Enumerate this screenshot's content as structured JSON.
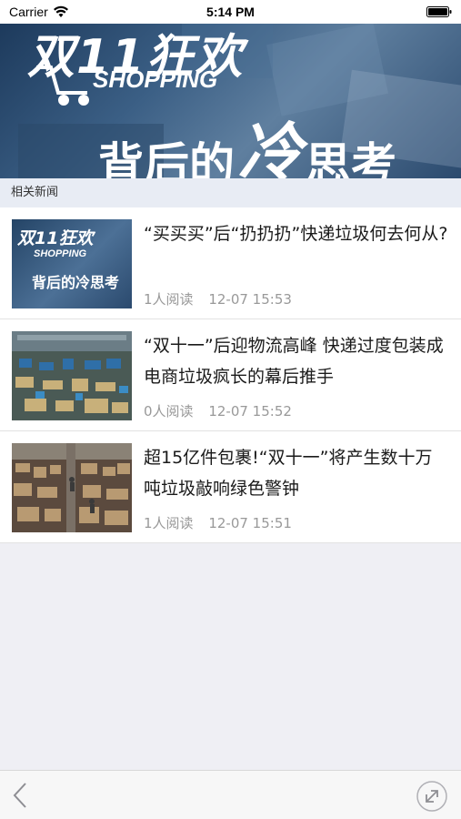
{
  "status_bar": {
    "carrier": "Carrier",
    "time": "5:14 PM"
  },
  "banner": {
    "headline_top": "双11狂欢",
    "headline_en": "SHOPPING",
    "headline_bottom_a": "背后的",
    "headline_bottom_b": "冷",
    "headline_bottom_c": "思考"
  },
  "section": {
    "title": "相关新闻"
  },
  "news": [
    {
      "title": "“买买买”后“扔扔扔”快递垃圾何去何从?",
      "reads": "1人阅读",
      "time": "12-07 15:53",
      "thumb_line1": "双11狂欢",
      "thumb_line2": "SHOPPING",
      "thumb_line3": "背后的冷思考"
    },
    {
      "title": "“双十一”后迎物流高峰 快递过度包装成电商垃圾疯长的幕后推手",
      "reads": "0人阅读",
      "time": "12-07 15:52"
    },
    {
      "title": "超15亿件包裹!“双十一”将产生数十万吨垃圾敲响绿色警钟",
      "reads": "1人阅读",
      "time": "12-07 15:51"
    }
  ],
  "toolbar": {
    "back_icon": "chevron-left-icon",
    "share_icon": "share-icon"
  },
  "colors": {
    "accent": "#999999",
    "section_bg": "#e8ecf4",
    "page_bg": "#efeff4"
  }
}
